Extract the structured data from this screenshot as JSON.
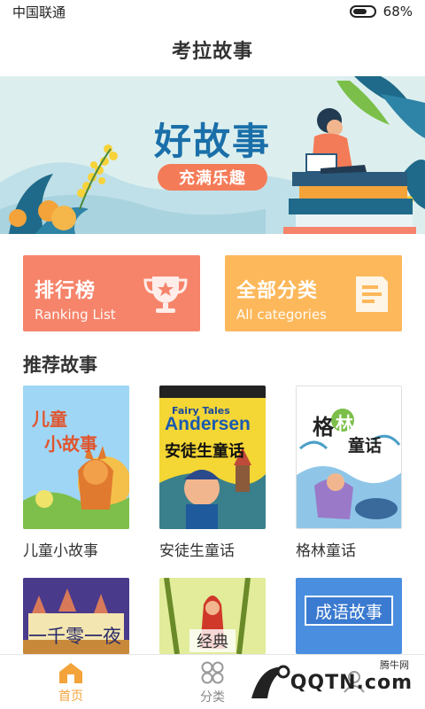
{
  "status_bar": {
    "carrier": "中国联通",
    "battery_percent_label": "68%",
    "battery_level": 0.68
  },
  "header": {
    "title": "考拉故事"
  },
  "banner": {
    "title": "好故事",
    "subtitle": "充满乐趣"
  },
  "cards": [
    {
      "title": "排行榜",
      "subtitle": "Ranking List",
      "icon": "trophy-icon",
      "color": "#f6846a"
    },
    {
      "title": "全部分类",
      "subtitle": "All categories",
      "icon": "document-icon",
      "color": "#fdb85b"
    }
  ],
  "section": {
    "title": "推荐故事"
  },
  "books": [
    {
      "title": "儿童小故事",
      "cover_text": [
        "儿童",
        "小故事"
      ]
    },
    {
      "title": "安徒生童话",
      "cover_text": [
        "Fairy Tales",
        "Andersen",
        "安徒生童话"
      ]
    },
    {
      "title": "格林童话",
      "cover_text": [
        "格",
        "林",
        "童话"
      ]
    },
    {
      "title": "",
      "cover_text": [
        "一千零一夜"
      ]
    },
    {
      "title": "",
      "cover_text": [
        "经典"
      ]
    },
    {
      "title": "",
      "cover_text": [
        "成语故事"
      ]
    }
  ],
  "bottom_nav": [
    {
      "label": "首页",
      "icon": "home-icon",
      "active": true
    },
    {
      "label": "分类",
      "icon": "grid-icon",
      "active": false
    },
    {
      "label": "",
      "icon": "user-icon",
      "active": false
    }
  ],
  "watermark": {
    "text": "QQTN.com",
    "small": "腾牛网"
  },
  "colors": {
    "accent": "#f3a33a",
    "banner_blue": "#1a6fa9",
    "coral": "#f47b58"
  }
}
